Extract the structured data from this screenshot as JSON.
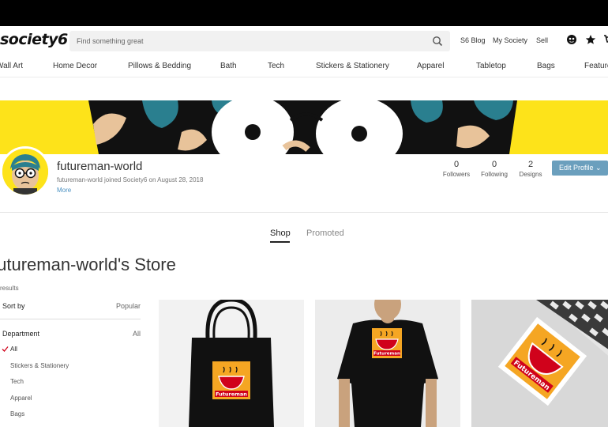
{
  "header": {
    "logo": "society6",
    "search_placeholder": "Find something great",
    "links": [
      "S6 Blog",
      "My Society",
      "Sell"
    ]
  },
  "nav": {
    "categories": [
      "Wall Art",
      "Home Decor",
      "Pillows & Bedding",
      "Bath",
      "Tech",
      "Stickers & Stationery",
      "Apparel",
      "Tabletop",
      "Bags",
      "Features"
    ]
  },
  "profile": {
    "username": "futureman-world",
    "joined": "futureman-world joined Society6 on August 28, 2018",
    "more": "More",
    "stats": [
      {
        "value": "0",
        "label": "Followers"
      },
      {
        "value": "0",
        "label": "Following"
      },
      {
        "value": "2",
        "label": "Designs"
      }
    ],
    "edit_button": "Edit Profile"
  },
  "tabs": [
    "Shop",
    "Promoted"
  ],
  "store": {
    "title": "futureman-world's Store",
    "results": "results"
  },
  "filters": {
    "sort_label": "Sort by",
    "sort_value": "Popular",
    "department_label": "Department",
    "department_value": "All",
    "department_items": [
      "All",
      "Stickers & Stationery",
      "Tech",
      "Apparel",
      "Bags"
    ]
  },
  "products": [
    {
      "type": "tote-bag",
      "logo_text": "Futureman"
    },
    {
      "type": "t-shirt",
      "logo_text": "Futureman"
    },
    {
      "type": "sticker",
      "logo_text": "Futureman"
    }
  ],
  "colors": {
    "banner_yellow": "#fde31a",
    "edit_button": "#6b9fbd",
    "logo_orange": "#f5a623",
    "logo_red": "#d0021b"
  }
}
